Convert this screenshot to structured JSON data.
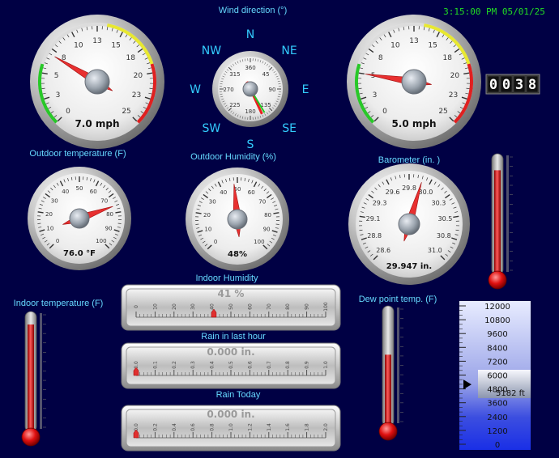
{
  "header": {
    "wind_speed_title": "",
    "gust_title": "",
    "wind_direction_title": "Wind direction (°)",
    "timestamp": "3:15:00 PM 05/01/25"
  },
  "wind_speed": {
    "readout": "7.0 mph",
    "min": 0,
    "max": 25,
    "value": 7.0,
    "ticks": [
      "0",
      "3",
      "5",
      "8",
      "10",
      "13",
      "15",
      "18",
      "20",
      "23",
      "25"
    ]
  },
  "gust": {
    "readout": "5.0 mph",
    "min": 0,
    "max": 25,
    "value": 5.0,
    "ticks": [
      "0",
      "3",
      "5",
      "8",
      "10",
      "13",
      "15",
      "18",
      "20",
      "23",
      "25"
    ]
  },
  "wind_direction": {
    "value_deg": 155,
    "compass": [
      "N",
      "NE",
      "E",
      "SE",
      "S",
      "SW",
      "W",
      "NW"
    ],
    "ticks": [
      "360",
      "45",
      "90",
      "135",
      "180",
      "225",
      "270",
      "315"
    ]
  },
  "odometer": {
    "digits": [
      "0",
      "0",
      "3",
      "8"
    ]
  },
  "outdoor_temperature": {
    "title": "Outdoor temperature (F)",
    "readout": "76.0 °F",
    "min": 0,
    "max": 100,
    "value": 76.0,
    "ticks": [
      "0",
      "10",
      "20",
      "30",
      "40",
      "50",
      "60",
      "70",
      "80",
      "90",
      "100"
    ]
  },
  "outdoor_humidity": {
    "title": "Outdoor Humidity (%)",
    "readout": "48%",
    "min": 0,
    "max": 100,
    "value": 48,
    "ticks": [
      "0",
      "10",
      "20",
      "30",
      "40",
      "50",
      "60",
      "70",
      "80",
      "90",
      "100"
    ]
  },
  "barometer": {
    "title": "Barometer (in. )",
    "readout": "29.947 in.",
    "min": 28.6,
    "max": 31.0,
    "value": 29.947,
    "ticks": [
      "28.6",
      "28.8",
      "29.1",
      "29.3",
      "29.6",
      "29.8",
      "30.0",
      "30.3",
      "30.5",
      "30.8",
      "31.0"
    ]
  },
  "indoor_temperature": {
    "title": "Indoor temperature (F)",
    "fill": 0.93
  },
  "indoor_humidity": {
    "title": "Indoor Humidity",
    "readout": "41 %",
    "value_fraction": 0.41,
    "ticks": [
      "0",
      "10",
      "20",
      "30",
      "40",
      "50",
      "60",
      "70",
      "80",
      "90",
      "100"
    ]
  },
  "rain_last_hour": {
    "title": "Rain in last hour",
    "readout": "0.000 in.",
    "value_fraction": 0.0,
    "ticks": [
      "0.0",
      "0.1",
      "0.2",
      "0.3",
      "0.4",
      "0.5",
      "0.6",
      "0.7",
      "0.8",
      "0.9",
      "1.0"
    ]
  },
  "rain_today": {
    "title": "Rain Today",
    "readout": "0.000 in.",
    "value_fraction": 0.0,
    "ticks": [
      "0.0",
      "0.2",
      "0.4",
      "0.6",
      "0.8",
      "1.0",
      "1.2",
      "1.4",
      "1.6",
      "1.8",
      "2.0"
    ]
  },
  "dew_point": {
    "title": "Dew point temp. (F)",
    "fill": 0.62
  },
  "right_thermometer": {
    "fill": 0.9
  },
  "cloud_base": {
    "readout": "5182 ft",
    "value": 5182,
    "min": 0,
    "max": 12000,
    "ticks": [
      "12000",
      "10800",
      "9600",
      "8400",
      "7200",
      "6000",
      "4800",
      "3600",
      "2400",
      "1200",
      "0"
    ]
  },
  "colors": {
    "background": "#000044",
    "label": "#66d9ff",
    "compass": "#33ccff",
    "clock": "#22dd22",
    "needle": "#e83030"
  }
}
